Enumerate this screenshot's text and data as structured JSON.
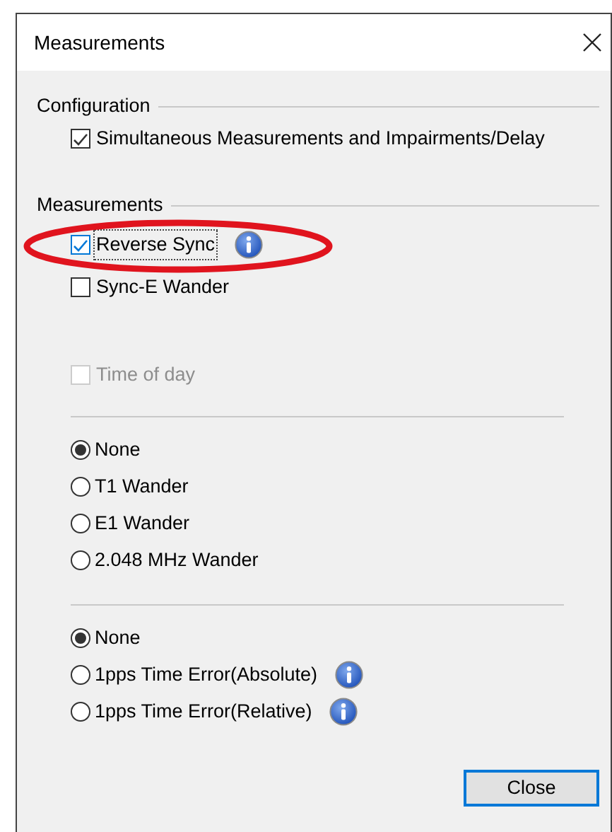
{
  "window": {
    "title": "Measurements"
  },
  "configuration": {
    "title": "Configuration",
    "items": [
      {
        "label": "Simultaneous Measurements and Impairments/Delay",
        "checked": true
      }
    ]
  },
  "measurements": {
    "title": "Measurements",
    "items": [
      {
        "label": "Reverse Sync",
        "checked": true,
        "focused": true,
        "info": true,
        "highlighted": true
      },
      {
        "label": "Sync-E Wander",
        "checked": false
      },
      {
        "label": "Time of day",
        "checked": false,
        "disabled": true
      }
    ]
  },
  "radio_groups": [
    [
      {
        "label": "None",
        "selected": true
      },
      {
        "label": "T1 Wander",
        "selected": false
      },
      {
        "label": "E1 Wander",
        "selected": false
      },
      {
        "label": "2.048 MHz Wander",
        "selected": false
      }
    ],
    [
      {
        "label": "None",
        "selected": true
      },
      {
        "label": "1pps Time Error(Absolute)",
        "selected": false,
        "info": true
      },
      {
        "label": "1pps Time Error(Relative)",
        "selected": false,
        "info": true
      }
    ]
  ],
  "buttons": [
    {
      "label": "Close",
      "default": true
    }
  ]
}
